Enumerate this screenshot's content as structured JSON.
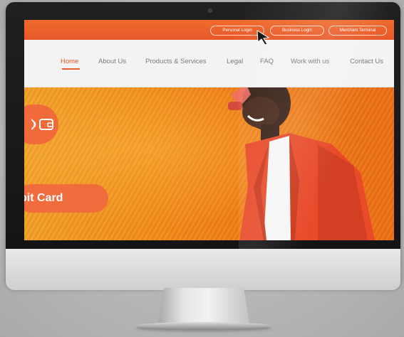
{
  "header": {
    "login_buttons": [
      {
        "label": "Personal Login"
      },
      {
        "label": "Business Login"
      },
      {
        "label": "Merchant Terminal"
      }
    ]
  },
  "nav": {
    "items": [
      {
        "label": "Home",
        "active": true
      },
      {
        "label": "About Us"
      },
      {
        "label": "Products & Services"
      },
      {
        "label": "Legal"
      },
      {
        "label": "FAQ"
      },
      {
        "label": "Work with us"
      },
      {
        "label": "Contact Us"
      }
    ]
  },
  "hero": {
    "banner_text": "bit Card",
    "icon": "wallet-contactless-icon"
  },
  "colors": {
    "brand_orange": "#ec5d2c",
    "top_bar": "#e8582a",
    "nav_text": "#7b7b7b",
    "hero_orange": "#ef8a1a"
  }
}
